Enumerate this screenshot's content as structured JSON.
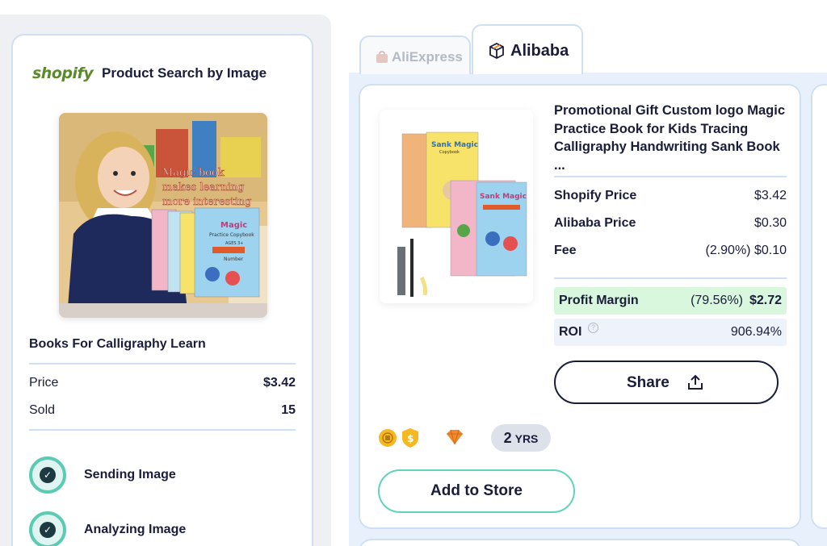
{
  "shopify_panel": {
    "logo_text": "shopify",
    "title": "Product Search by Image",
    "product_image": {
      "overlay_lines": [
        "Magic book",
        "makes learning",
        "more interesting"
      ],
      "book_title": "Magic",
      "book_subtitle": "Practice Copybook",
      "book_ages": "AGES 3+",
      "book_topic": "Number"
    },
    "product_name": "Books For Calligraphy Learn",
    "price_label": "Price",
    "price_value": "$3.42",
    "sold_label": "Sold",
    "sold_value": "15",
    "steps": [
      {
        "label": "Sending Image"
      },
      {
        "label": "Analyzing Image"
      }
    ]
  },
  "tabs": [
    {
      "label": "AliExpress",
      "icon": "aliexpress-icon",
      "active": false
    },
    {
      "label": "Alibaba",
      "icon": "alibaba-icon",
      "active": true
    }
  ],
  "result": {
    "book_cover_text": "Sank Magic",
    "book_cover_sub": "Copybook",
    "title": "Promotional Gift Custom logo Magic Practice Book for Kids Tracing Calligraphy Handwriting Sank Book ...",
    "rows": [
      {
        "label": "Shopify Price",
        "value": "$3.42"
      },
      {
        "label": "Alibaba Price",
        "value": "$0.30"
      },
      {
        "label": "Fee",
        "value": "(2.90%) $0.10"
      }
    ],
    "profit_label": "Profit Margin",
    "profit_pct": "(79.56%)",
    "profit_value": "$2.72",
    "roi_label": "ROI",
    "roi_value": "906.94%",
    "share_label": "Share",
    "years_number": "2",
    "years_unit": "YRS",
    "add_label": "Add to Store",
    "badges": [
      "gold-medal-icon",
      "verified-shield-icon",
      "diamond-icon"
    ]
  },
  "colors": {
    "navy": "#1a1d3a",
    "accent_teal": "#62d2bd",
    "border_blue": "#cfe0f5",
    "profit_green": "#d8f7dc",
    "shopify_green": "#5a8a2a",
    "diamond_orange": "#f08a2a"
  }
}
